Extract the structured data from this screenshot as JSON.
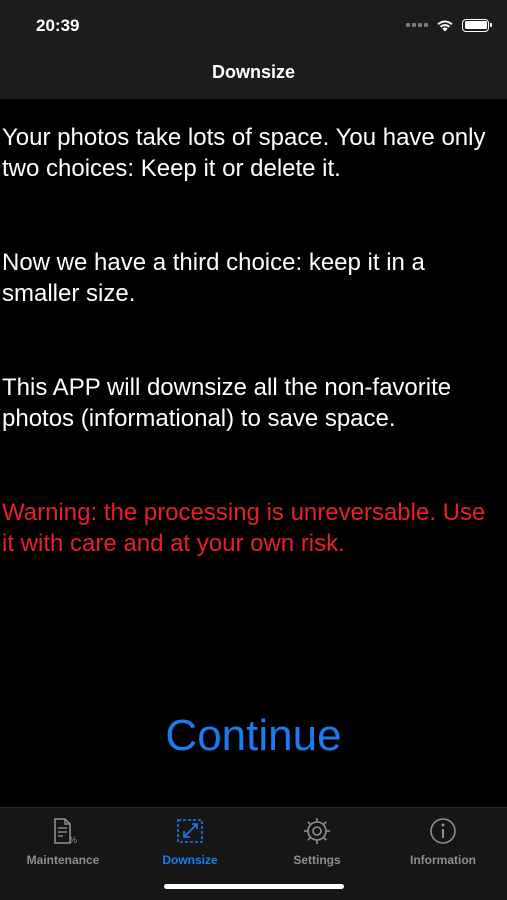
{
  "status_bar": {
    "time": "20:39"
  },
  "nav": {
    "title": "Downsize"
  },
  "content": {
    "paragraphs": [
      "Your photos take lots of space.  You have only two choices:  Keep it or delete it.",
      "Now we have a third choice: keep it in a smaller size.",
      "This APP will downsize all the non-favorite photos (informational) to save space."
    ],
    "warning": "Warning:  the processing is unreversable. Use it with care and at your own risk."
  },
  "continue_button": {
    "label": "Continue"
  },
  "tabs": [
    {
      "label": "Maintenance",
      "icon": "document-icon",
      "active": false
    },
    {
      "label": "Downsize",
      "icon": "downsize-icon",
      "active": true
    },
    {
      "label": "Settings",
      "icon": "gear-icon",
      "active": false
    },
    {
      "label": "Information",
      "icon": "info-icon",
      "active": false
    }
  ],
  "colors": {
    "accent": "#1b7cf2",
    "warning": "#e8202a",
    "inactive": "#8e8e93"
  }
}
